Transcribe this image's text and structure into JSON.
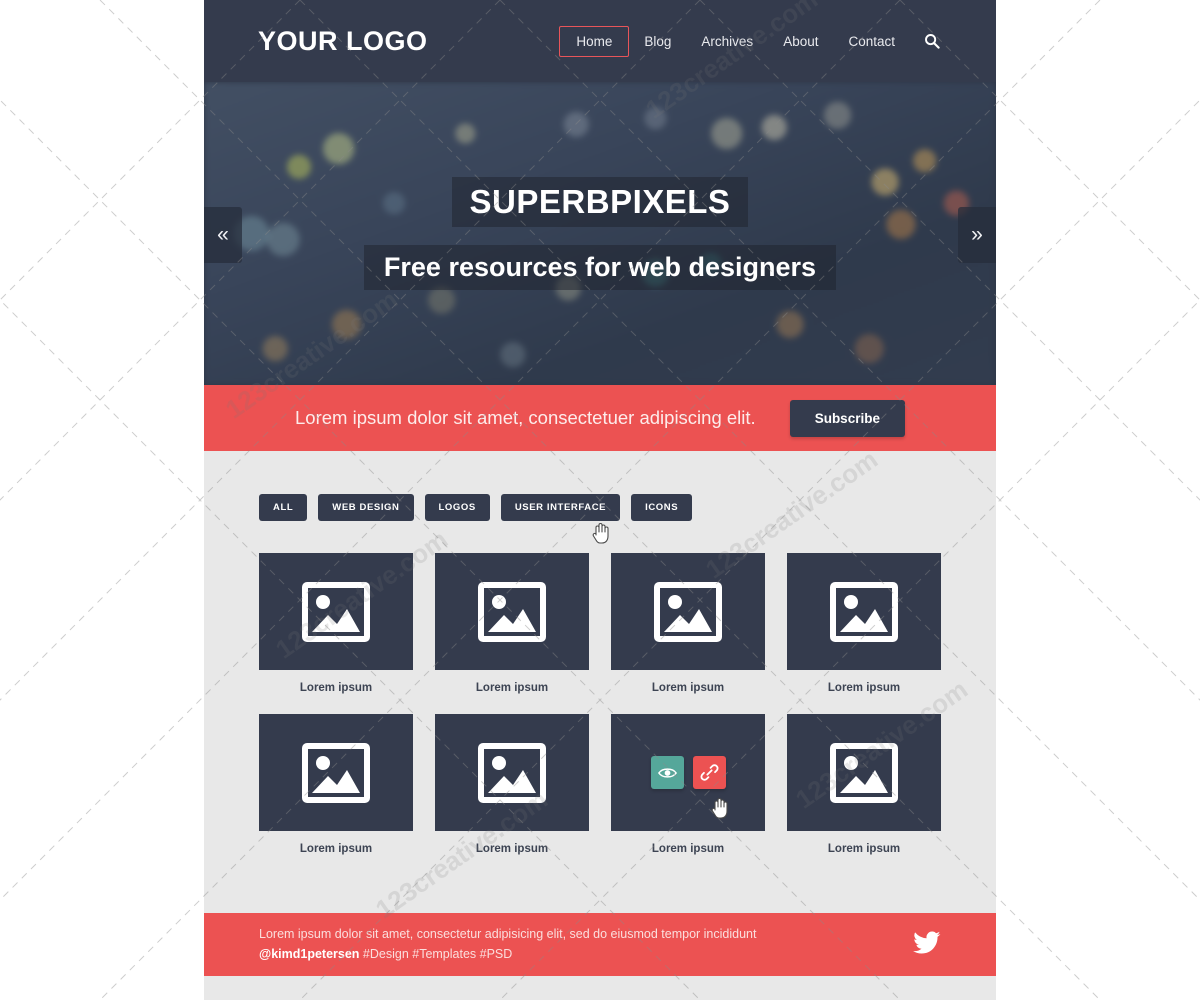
{
  "header": {
    "logo": "YOUR LOGO",
    "nav": [
      {
        "label": "Home",
        "active": true
      },
      {
        "label": "Blog",
        "active": false
      },
      {
        "label": "Archives",
        "active": false
      },
      {
        "label": "About",
        "active": false
      },
      {
        "label": "Contact",
        "active": false
      }
    ],
    "search_icon": "search-icon",
    "bg_color": "#343b4d",
    "active_border_color": "#e8555a"
  },
  "hero": {
    "title": "SUPERBPIXELS",
    "subtitle": "Free resources for web designers",
    "prev_arrow": "«",
    "next_arrow": "»"
  },
  "subscribe": {
    "text": "Lorem ipsum dolor sit amet, consectetuer adipiscing elit.",
    "button_label": "Subscribe",
    "bar_color": "#ec5252",
    "button_color": "#343b4d"
  },
  "portfolio": {
    "filters": [
      {
        "label": "ALL"
      },
      {
        "label": "WEB DESIGN"
      },
      {
        "label": "LOGOS"
      },
      {
        "label": "USER INTERFACE"
      },
      {
        "label": "ICONS"
      }
    ],
    "items": [
      {
        "caption": "Lorem ipsum",
        "hovered": false
      },
      {
        "caption": "Lorem ipsum",
        "hovered": false
      },
      {
        "caption": "Lorem ipsum",
        "hovered": false
      },
      {
        "caption": "Lorem ipsum",
        "hovered": false
      },
      {
        "caption": "Lorem ipsum",
        "hovered": false
      },
      {
        "caption": "Lorem ipsum",
        "hovered": false
      },
      {
        "caption": "Lorem ipsum",
        "hovered": true
      },
      {
        "caption": "Lorem ipsum",
        "hovered": false
      }
    ],
    "hover_actions": {
      "preview_icon": "eye-icon",
      "preview_color": "#55a79a",
      "link_icon": "link-chain-icon",
      "link_color": "#ec5252"
    },
    "card_color": "#343b4d",
    "background_color": "#e8e8e8"
  },
  "footer": {
    "line1": "Lorem ipsum dolor sit amet, consectetur adipisicing elit, sed do eiusmod tempor incididunt",
    "handle": "@kimd1petersen",
    "tags": "#Design #Templates #PSD",
    "social_icon": "twitter-icon",
    "bar_color": "#ec5252"
  },
  "watermark": {
    "text": "123creative.com"
  }
}
